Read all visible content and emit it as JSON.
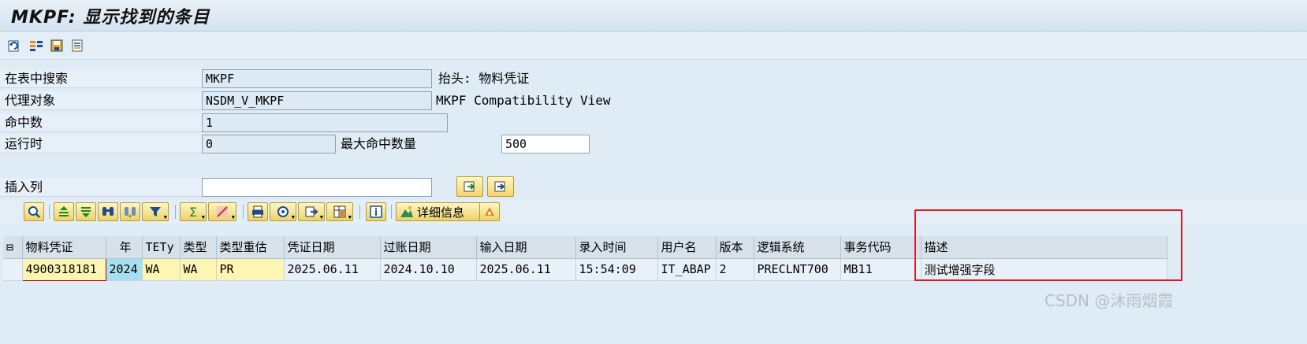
{
  "window": {
    "title": "MKPF: 显示找到的条目"
  },
  "app_toolbar": {
    "icons": [
      "refresh-icon",
      "select-fields-icon",
      "save-variant-icon",
      "list-icon"
    ]
  },
  "form": {
    "search_in_table": {
      "label": "在表中搜索",
      "value": "MKPF",
      "desc": "抬头: 物料凭证"
    },
    "proxy_object": {
      "label": "代理对象",
      "value": "NSDM_V_MKPF",
      "desc": "MKPF Compatibility View"
    },
    "hit_count": {
      "label": "命中数",
      "value": "1"
    },
    "runtime": {
      "label": "运行时",
      "value": "0"
    },
    "max_hits": {
      "label": "最大命中数量",
      "value": "500"
    },
    "insert_column": {
      "label": "插入列",
      "value": ""
    }
  },
  "grid_toolbar": {
    "detail_label": "详细信息",
    "icons": [
      "details-icon",
      "sort-asc-icon",
      "sort-desc-icon",
      "find-icon",
      "find-next-icon",
      "filter-icon",
      "sum-icon",
      "subtotal-icon",
      "print-icon",
      "view-icon",
      "export-icon",
      "layout-icon",
      "info-icon",
      "detail-icon",
      "abc-icon"
    ]
  },
  "table": {
    "columns": [
      "物料凭证",
      "年",
      "TETy",
      "类型",
      "类型重估",
      "凭证日期",
      "过账日期",
      "输入日期",
      "录入时间",
      "用户名",
      "版本",
      "逻辑系统",
      "事务代码",
      "描述"
    ],
    "rows": [
      [
        "4900318181",
        "2024",
        "WA",
        "WA",
        "PR",
        "2025.06.11",
        "2024.10.10",
        "2025.06.11",
        "15:54:09",
        "IT_ABAP",
        "2",
        "PRECLNT700",
        "MB11",
        "测试增强字段"
      ]
    ]
  },
  "watermark": "CSDN @沐雨烟霞",
  "colors": {
    "highlight": "#e6141e",
    "key_cell": "#fdf6b2",
    "year_cell": "#a8dff0"
  }
}
